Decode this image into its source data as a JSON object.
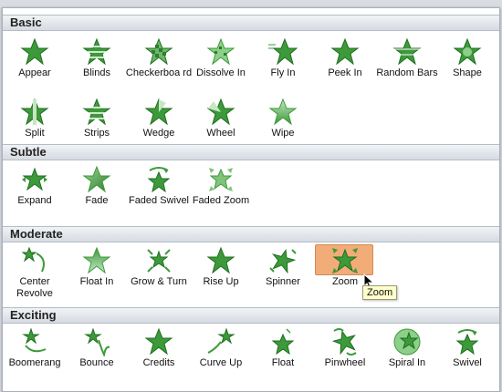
{
  "sections": [
    {
      "title": "Basic",
      "items": [
        {
          "label": "Appear",
          "icon": "star-appear-icon"
        },
        {
          "label": "Blinds",
          "icon": "star-blinds-icon"
        },
        {
          "label": "Checkerboa rd",
          "icon": "star-checkerboard-icon"
        },
        {
          "label": "Dissolve In",
          "icon": "star-dissolve-icon"
        },
        {
          "label": "Fly In",
          "icon": "star-fly-in-icon"
        },
        {
          "label": "Peek In",
          "icon": "star-peek-in-icon"
        },
        {
          "label": "Random Bars",
          "icon": "star-random-bars-icon"
        },
        {
          "label": "Shape",
          "icon": "star-shape-icon"
        },
        {
          "label": "Split",
          "icon": "star-split-icon"
        },
        {
          "label": "Strips",
          "icon": "star-strips-icon"
        },
        {
          "label": "Wedge",
          "icon": "star-wedge-icon"
        },
        {
          "label": "Wheel",
          "icon": "star-wheel-icon"
        },
        {
          "label": "Wipe",
          "icon": "star-wipe-icon"
        }
      ]
    },
    {
      "title": "Subtle",
      "items": [
        {
          "label": "Expand",
          "icon": "star-expand-icon"
        },
        {
          "label": "Fade",
          "icon": "star-fade-icon"
        },
        {
          "label": "Faded Swivel",
          "icon": "star-faded-swivel-icon"
        },
        {
          "label": "Faded Zoom",
          "icon": "star-faded-zoom-icon"
        }
      ]
    },
    {
      "title": "Moderate",
      "items": [
        {
          "label": "Center Revolve",
          "icon": "star-center-revolve-icon"
        },
        {
          "label": "Float In",
          "icon": "star-float-in-icon"
        },
        {
          "label": "Grow & Turn",
          "icon": "star-grow-turn-icon"
        },
        {
          "label": "Rise Up",
          "icon": "star-rise-up-icon"
        },
        {
          "label": "Spinner",
          "icon": "star-spinner-icon"
        },
        {
          "label": "Zoom",
          "icon": "star-zoom-icon",
          "selected": true
        }
      ]
    },
    {
      "title": "Exciting",
      "items": [
        {
          "label": "Boomerang",
          "icon": "star-boomerang-icon"
        },
        {
          "label": "Bounce",
          "icon": "star-bounce-icon"
        },
        {
          "label": "Credits",
          "icon": "star-credits-icon"
        },
        {
          "label": "Curve Up",
          "icon": "star-curve-up-icon"
        },
        {
          "label": "Float",
          "icon": "star-float-icon"
        },
        {
          "label": "Pinwheel",
          "icon": "star-pinwheel-icon"
        },
        {
          "label": "Spiral In",
          "icon": "star-spiral-in-icon"
        },
        {
          "label": "Swivel",
          "icon": "star-swivel-icon"
        }
      ]
    }
  ],
  "tooltip": "Zoom",
  "colors": {
    "star": "#3d9a3a",
    "star_dark": "#1f6e1f",
    "selected": "#f1ac78"
  }
}
